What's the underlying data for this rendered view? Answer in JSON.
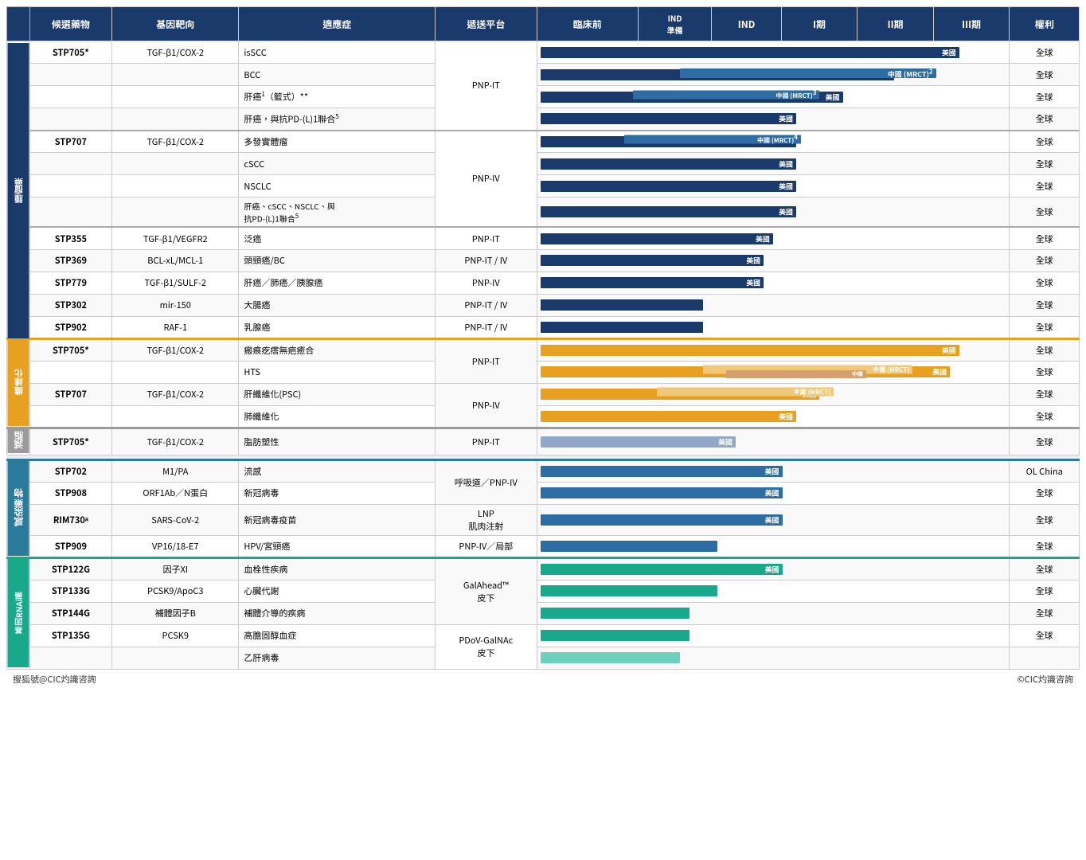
{
  "headers": {
    "drug": "候選藥物",
    "gene": "基因靶向",
    "indication": "適應症",
    "delivery": "遞送平台",
    "preclinical": "臨床前",
    "ind_prep": "IND\n準備",
    "ind": "IND",
    "phase1": "I期",
    "phase2": "II期",
    "phase3": "III期",
    "rights": "權利"
  },
  "categories": [
    {
      "id": "oncology",
      "label": "腫瘤藥",
      "rows": 14
    },
    {
      "id": "fibrosis",
      "label": "纖維化",
      "rows": 5
    },
    {
      "id": "metabolic",
      "label": "減脂",
      "rows": 1
    },
    {
      "id": "infectious",
      "label": "感染藥物",
      "rows": 4
    },
    {
      "id": "genetic",
      "label": "基因RNAi藥",
      "rows": 5
    }
  ],
  "rows": [
    {
      "category": "oncology",
      "drug": "STP705*",
      "gene": "TGF-β1/COX-2",
      "indication": "isSCC",
      "delivery": "PNP-IT",
      "bar_color": "dark-blue",
      "bar_start": 0,
      "bar_end": 85,
      "bar_label": "美國",
      "bar_label_pos": 82,
      "rights": "全球"
    },
    {
      "category": "oncology",
      "drug": "",
      "gene": "",
      "indication": "BCC",
      "delivery": "",
      "bar_color": "dark-blue",
      "bar2_color": "mid-blue",
      "rights": "全球"
    },
    {
      "category": "oncology",
      "drug": "",
      "gene": "",
      "indication": "肝癌¹（籃式）**",
      "delivery": "",
      "rights": "全球"
    },
    {
      "category": "oncology",
      "drug": "",
      "gene": "",
      "indication": "肝癌，與抗PD-(L)1聯合⁵",
      "delivery": "",
      "rights": "全球"
    },
    {
      "category": "oncology",
      "drug": "STP707",
      "gene": "TGF-β1/COX-2",
      "indication": "多發實體瘤",
      "delivery": "PNP-IV",
      "rights": "全球"
    },
    {
      "category": "oncology",
      "drug": "",
      "gene": "",
      "indication": "cSCC",
      "delivery": "",
      "rights": "全球"
    },
    {
      "category": "oncology",
      "drug": "",
      "gene": "",
      "indication": "NSCLC",
      "delivery": "",
      "rights": "全球"
    },
    {
      "category": "oncology",
      "drug": "",
      "gene": "",
      "indication": "肝癌、cSCC、NSCLC、與抗PD-(L)1聯合⁵",
      "delivery": "",
      "rights": "全球"
    },
    {
      "category": "oncology",
      "drug": "STP355",
      "gene": "TGF-β1/VEGFR2",
      "indication": "泛癌",
      "delivery": "PNP-IT",
      "rights": "全球"
    },
    {
      "category": "oncology",
      "drug": "STP369",
      "gene": "BCL-xL/MCL-1",
      "indication": "頭頸癌/BC",
      "delivery": "PNP-IT / IV",
      "rights": "全球"
    },
    {
      "category": "oncology",
      "drug": "STP779",
      "gene": "TGF-β1/SULF-2",
      "indication": "肝癌／肺癌／胰腺癌",
      "delivery": "PNP-IV",
      "rights": "全球"
    },
    {
      "category": "oncology",
      "drug": "STP302",
      "gene": "mir-150",
      "indication": "大腸癌",
      "delivery": "PNP-IT / IV",
      "rights": "全球"
    },
    {
      "category": "oncology",
      "drug": "STP902",
      "gene": "RAF-1",
      "indication": "乳腺癌",
      "delivery": "PNP-IT / IV",
      "rights": "全球"
    },
    {
      "category": "fibrosis",
      "drug": "STP705*",
      "gene": "TGF-β1/COX-2",
      "indication": "瘢痕疙瘩無疤癒合",
      "delivery": "PNP-IT",
      "rights": "全球"
    },
    {
      "category": "fibrosis",
      "drug": "",
      "gene": "",
      "indication": "HTS",
      "delivery": "",
      "rights": "全球"
    },
    {
      "category": "fibrosis",
      "drug": "STP707",
      "gene": "TGF-β1/COX-2",
      "indication": "肝纖維化(PSC)",
      "delivery": "PNP-IV",
      "rights": "全球"
    },
    {
      "category": "fibrosis",
      "drug": "",
      "gene": "",
      "indication": "肺纖維化",
      "delivery": "",
      "rights": "全球"
    },
    {
      "category": "metabolic",
      "drug": "STP705*",
      "gene": "TGF-β1/COX-2",
      "indication": "脂肪塑性",
      "delivery": "PNP-IT",
      "rights": "全球"
    },
    {
      "category": "infectious",
      "drug": "STP702",
      "gene": "M1/PA",
      "indication": "流感",
      "delivery": "呼吸道／PNP-IV",
      "rights": "OL China"
    },
    {
      "category": "infectious",
      "drug": "STP908",
      "gene": "ORF1Ab／N蛋白",
      "indication": "新冠病毒",
      "delivery": "",
      "rights": "全球"
    },
    {
      "category": "infectious",
      "drug": "RIM730ᵃ",
      "gene": "SARS-CoV-2",
      "indication": "新冠病毒疫苗",
      "delivery": "LNP\n肌肉注射",
      "rights": "全球"
    },
    {
      "category": "infectious",
      "drug": "STP909",
      "gene": "VP16/18-E7",
      "indication": "HPV/宮頸癌",
      "delivery": "PNP-IV／局部",
      "rights": "全球"
    },
    {
      "category": "genetic",
      "drug": "STP122G",
      "gene": "因子XI",
      "indication": "血栓性疾病",
      "delivery": "GalAhead™\n皮下",
      "rights": "全球"
    },
    {
      "category": "genetic",
      "drug": "STP133G",
      "gene": "PCSK9/ApoC3",
      "indication": "心臟代謝",
      "delivery": "",
      "rights": "全球"
    },
    {
      "category": "genetic",
      "drug": "STP144G",
      "gene": "補體因子B",
      "indication": "補體介導的疾病",
      "delivery": "",
      "rights": "全球"
    },
    {
      "category": "genetic",
      "drug": "STP135G",
      "gene": "PCSK9",
      "indication": "高膽固醇血症",
      "delivery": "PDoV-GalNAc\n皮下",
      "rights": "全球"
    },
    {
      "category": "genetic",
      "drug": "",
      "gene": "",
      "indication": "乙肝病毒",
      "delivery": "",
      "rights": ""
    }
  ],
  "footer": {
    "left": "搜狐號@CIC灼識咨詢",
    "right": "©CIC灼識咨詢"
  }
}
